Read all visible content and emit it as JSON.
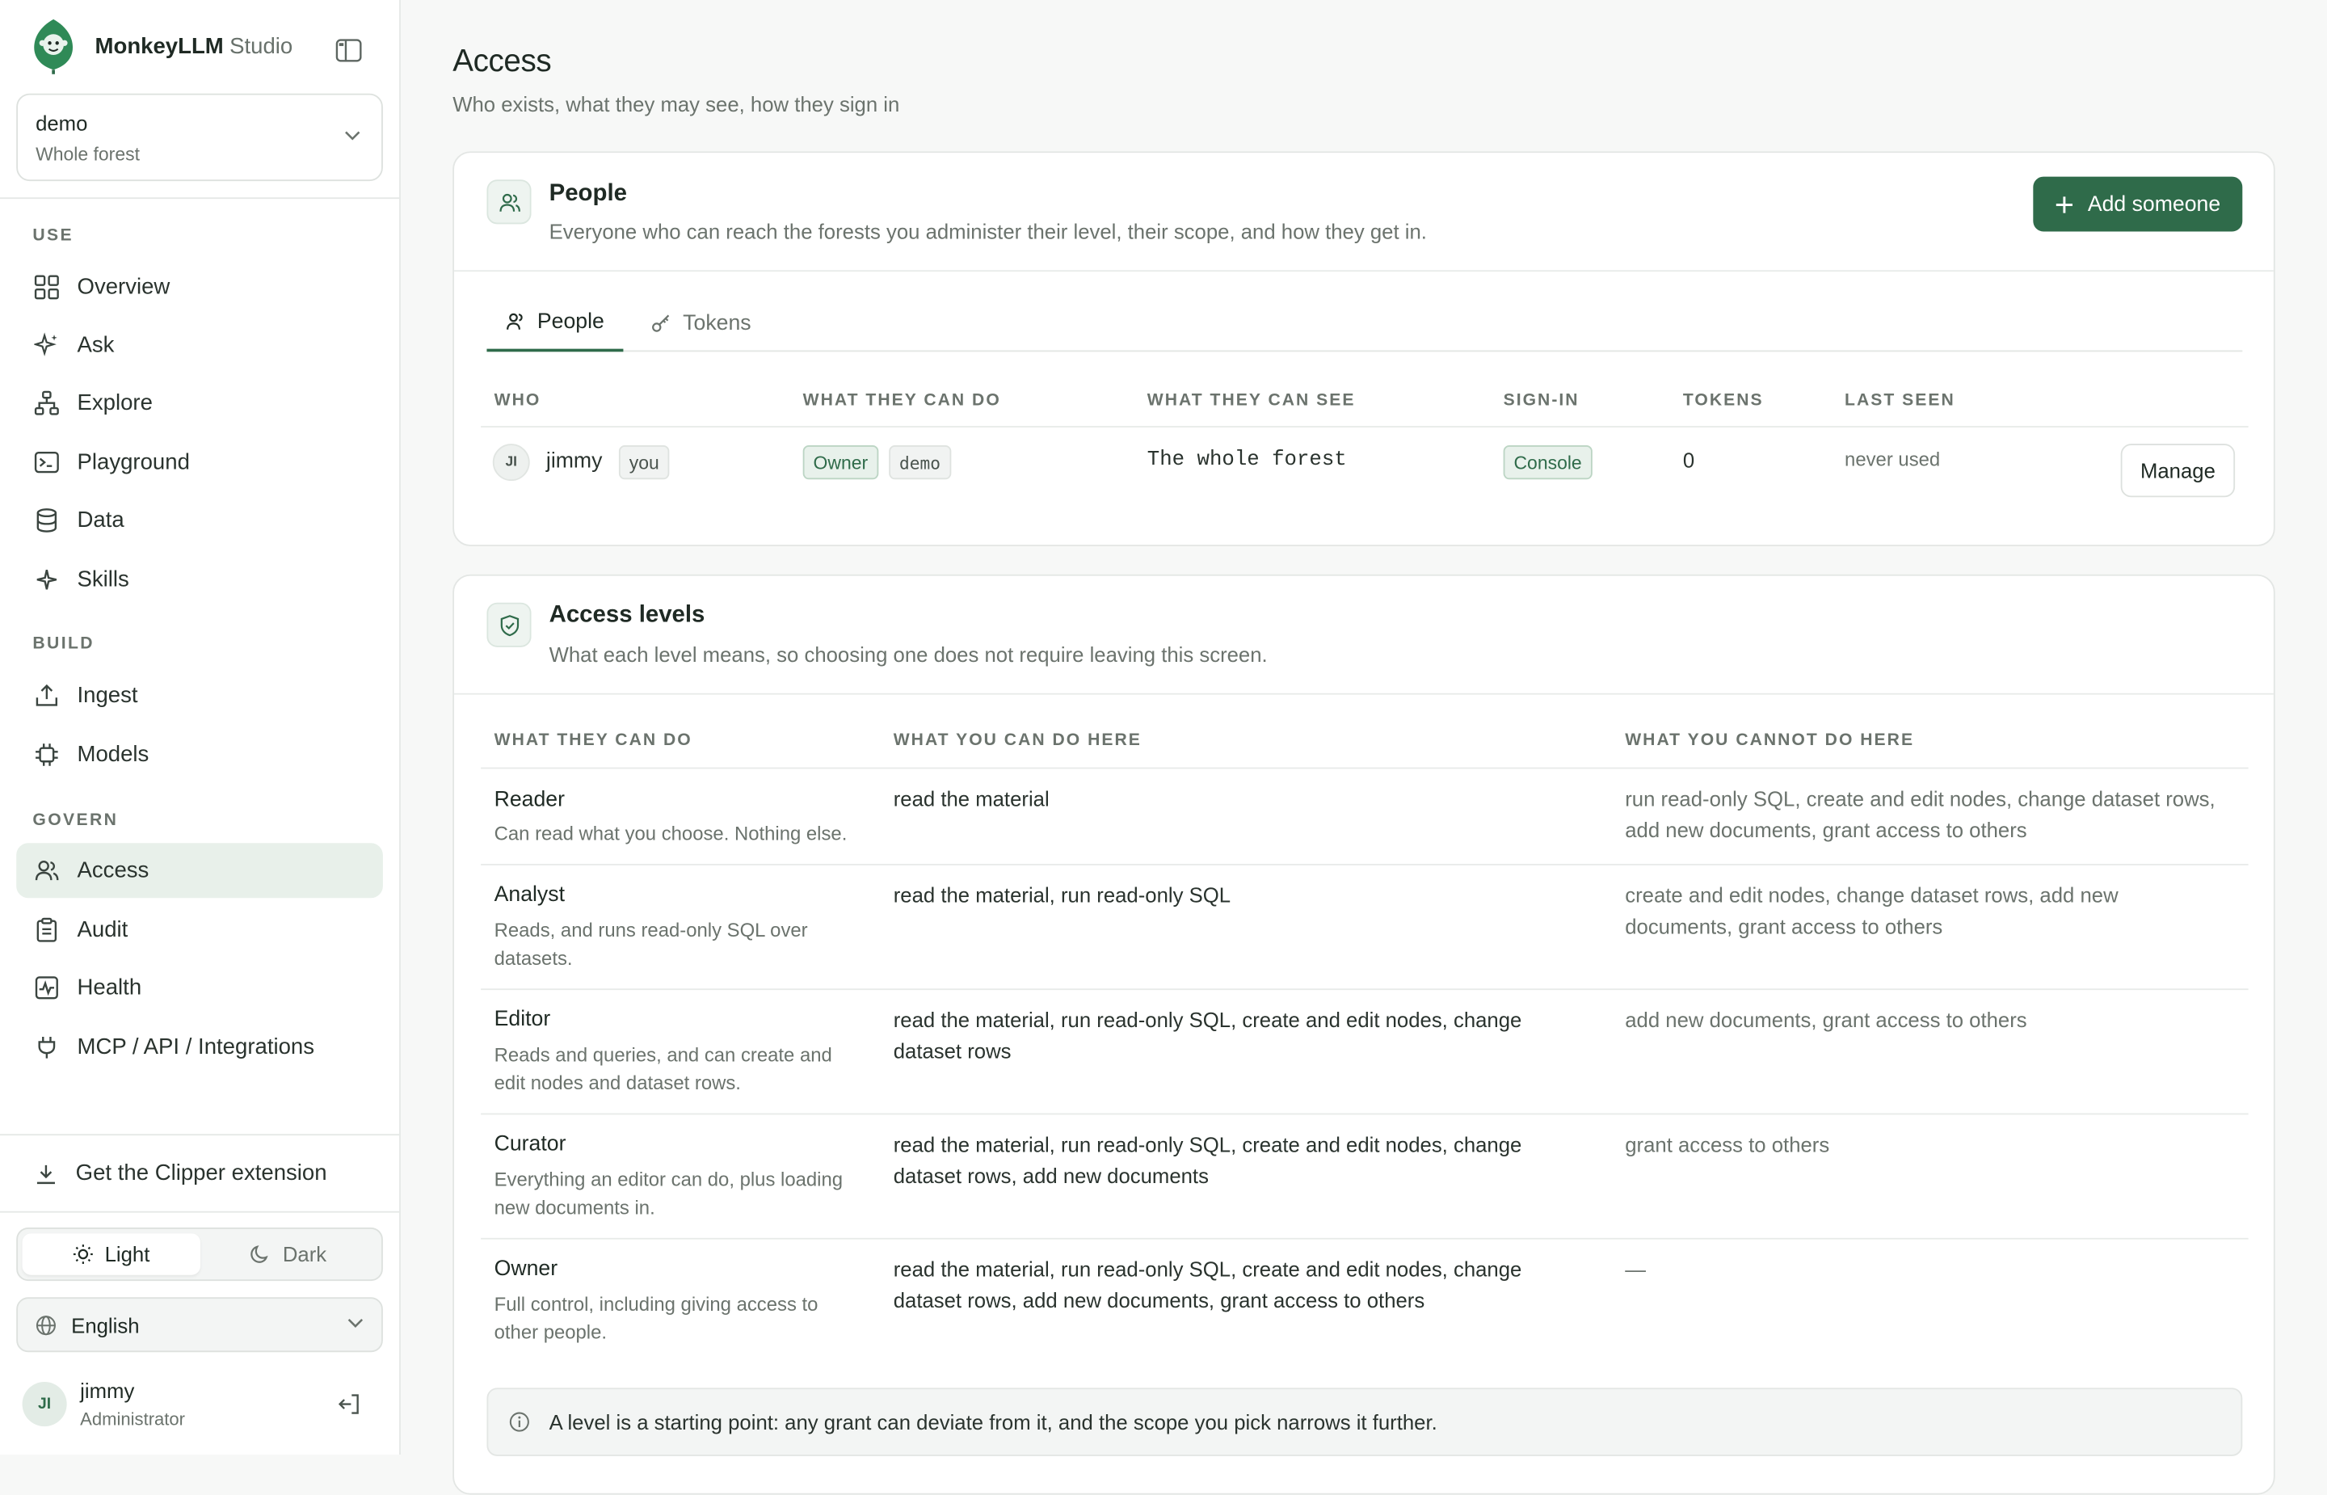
{
  "brand": {
    "name": "MonkeyLLM",
    "suffix": "Studio"
  },
  "forest_selector": {
    "name": "demo",
    "scope": "Whole forest"
  },
  "sidebar": {
    "sections": {
      "use": "USE",
      "build": "BUILD",
      "govern": "GOVERN"
    },
    "items": [
      {
        "label": "Overview",
        "icon": "grid-icon"
      },
      {
        "label": "Ask",
        "icon": "sparkle-icon"
      },
      {
        "label": "Explore",
        "icon": "hierarchy-icon"
      },
      {
        "label": "Playground",
        "icon": "terminal-icon"
      },
      {
        "label": "Data",
        "icon": "database-icon"
      },
      {
        "label": "Skills",
        "icon": "star-icon"
      },
      {
        "label": "Ingest",
        "icon": "upload-icon"
      },
      {
        "label": "Models",
        "icon": "chip-icon"
      },
      {
        "label": "Access",
        "icon": "users-icon",
        "active": true
      },
      {
        "label": "Audit",
        "icon": "clipboard-icon"
      },
      {
        "label": "Health",
        "icon": "activity-icon"
      },
      {
        "label": "MCP / API / Integrations",
        "icon": "plug-icon"
      }
    ],
    "clipper": "Get the Clipper extension",
    "theme": {
      "light": "Light",
      "dark": "Dark",
      "selected": "Light"
    },
    "language": "English",
    "user": {
      "initials": "JI",
      "name": "jimmy",
      "role": "Administrator"
    }
  },
  "page": {
    "title": "Access",
    "subtitle": "Who exists, what they may see, how they sign in"
  },
  "people_card": {
    "title": "People",
    "description": "Everyone who can reach the forests you administer their level, their scope, and how they get in.",
    "add_button": "Add someone",
    "tabs": [
      {
        "label": "People",
        "active": true
      },
      {
        "label": "Tokens",
        "active": false
      }
    ],
    "columns": {
      "who": "WHO",
      "can_do": "WHAT THEY CAN DO",
      "can_see": "WHAT THEY CAN SEE",
      "sign_in": "SIGN-IN",
      "tokens": "TOKENS",
      "last_seen": "LAST SEEN"
    },
    "rows": [
      {
        "initials": "JI",
        "name": "jimmy",
        "badge": "you",
        "level": "Owner",
        "forest": "demo",
        "scope": "The whole forest",
        "sign_in": "Console",
        "tokens": "0",
        "last_seen": "never used",
        "action": "Manage"
      }
    ]
  },
  "levels_card": {
    "title": "Access levels",
    "description": "What each level means, so choosing one does not require leaving this screen.",
    "columns": {
      "can_do": "WHAT THEY CAN DO",
      "here": "WHAT YOU CAN DO HERE",
      "not_here": "WHAT YOU CANNOT DO HERE"
    },
    "levels": [
      {
        "name": "Reader",
        "desc": "Can read what you choose. Nothing else.",
        "can": "read the material",
        "cannot": "run read-only SQL, create and edit nodes, change dataset rows, add new documents, grant access to others"
      },
      {
        "name": "Analyst",
        "desc": "Reads, and runs read-only SQL over datasets.",
        "can": "read the material, run read-only SQL",
        "cannot": "create and edit nodes, change dataset rows, add new documents, grant access to others"
      },
      {
        "name": "Editor",
        "desc": "Reads and queries, and can create and edit nodes and dataset rows.",
        "can": "read the material, run read-only SQL, create and edit nodes, change dataset rows",
        "cannot": "add new documents, grant access to others"
      },
      {
        "name": "Curator",
        "desc": "Everything an editor can do, plus loading new documents in.",
        "can": "read the material, run read-only SQL, create and edit nodes, change dataset rows, add new documents",
        "cannot": "grant access to others"
      },
      {
        "name": "Owner",
        "desc": "Full control, including giving access to other people.",
        "can": "read the material, run read-only SQL, create and edit nodes, change dataset rows, add new documents, grant access to others",
        "cannot": "—"
      }
    ],
    "note": "A level is a starting point: any grant can deviate from it, and the scope you pick narrows it further."
  },
  "colors": {
    "accent": "#2f6b4a",
    "accent_soft": "#e8f0ea",
    "text": "#1f2a24",
    "muted": "#6b736d"
  }
}
